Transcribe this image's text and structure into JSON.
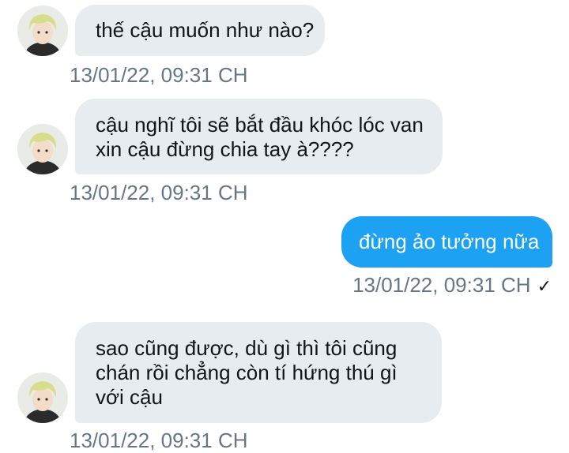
{
  "conversation": {
    "messages": [
      {
        "direction": "received",
        "lines": [
          "thế cậu muốn như nào?"
        ],
        "timestamp": "13/01/22, 09:31 CH"
      },
      {
        "direction": "received",
        "lines": [
          "cậu nghĩ tôi sẽ bắt đầu khóc lóc van",
          "xin cậu đừng chia tay à????"
        ],
        "timestamp": "13/01/22, 09:31 CH"
      },
      {
        "direction": "sent",
        "lines": [
          "đừng ảo tưởng nữa"
        ],
        "timestamp": "13/01/22, 09:31 CH",
        "status_icon": "checkmark-icon",
        "status_glyph": "✓"
      },
      {
        "direction": "received",
        "lines": [
          "sao cũng được, dù gì thì tôi cũng",
          "chán rồi chẳng còn tí hứng thú gì",
          "với cậu"
        ],
        "timestamp": "13/01/22, 09:31 CH"
      }
    ]
  },
  "colors": {
    "received_bubble": "#e6ecf0",
    "sent_bubble": "#1da1f2",
    "timestamp_text": "#657786"
  }
}
